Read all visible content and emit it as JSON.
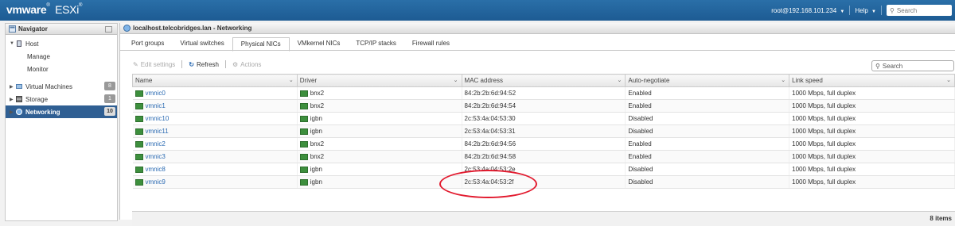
{
  "header": {
    "brand_vm": "vm",
    "brand_ware": "ware",
    "brand_reg": "®",
    "brand_esxi": "ESXi",
    "user": "root@192.168.101.234",
    "help": "Help",
    "search_placeholder": "Search"
  },
  "navigator": {
    "title": "Navigator",
    "host_label": "Host",
    "host_children": [
      "Manage",
      "Monitor"
    ],
    "items": [
      {
        "label": "Virtual Machines",
        "badge": "8"
      },
      {
        "label": "Storage",
        "badge": "1"
      },
      {
        "label": "Networking",
        "badge": "10"
      }
    ]
  },
  "main": {
    "title": "localhost.telcobridges.lan - Networking",
    "tabs": [
      "Port groups",
      "Virtual switches",
      "Physical NICs",
      "VMkernel NICs",
      "TCP/IP stacks",
      "Firewall rules"
    ],
    "active_tab": "Physical NICs",
    "toolbar": {
      "edit": "Edit settings",
      "refresh": "Refresh",
      "actions": "Actions"
    },
    "search_placeholder": "Search",
    "columns": [
      "Name",
      "Driver",
      "MAC address",
      "Auto-negotiate",
      "Link speed"
    ],
    "rows": [
      [
        "vmnic0",
        "bnx2",
        "84:2b:2b:6d:94:52",
        "Enabled",
        "1000 Mbps, full duplex"
      ],
      [
        "vmnic1",
        "bnx2",
        "84:2b:2b:6d:94:54",
        "Enabled",
        "1000 Mbps, full duplex"
      ],
      [
        "vmnic10",
        "igbn",
        "2c:53:4a:04:53:30",
        "Disabled",
        "1000 Mbps, full duplex"
      ],
      [
        "vmnic11",
        "igbn",
        "2c:53:4a:04:53:31",
        "Disabled",
        "1000 Mbps, full duplex"
      ],
      [
        "vmnic2",
        "bnx2",
        "84:2b:2b:6d:94:56",
        "Enabled",
        "1000 Mbps, full duplex"
      ],
      [
        "vmnic3",
        "bnx2",
        "84:2b:2b:6d:94:58",
        "Enabled",
        "1000 Mbps, full duplex"
      ],
      [
        "vmnic8",
        "igbn",
        "2c:53:4a:04:53:2e",
        "Disabled",
        "1000 Mbps, full duplex"
      ],
      [
        "vmnic9",
        "igbn",
        "2c:53:4a:04:53:2f",
        "Disabled",
        "1000 Mbps, full duplex"
      ]
    ],
    "footer_count": "8 items",
    "annotation_color": "#e21b2f"
  }
}
